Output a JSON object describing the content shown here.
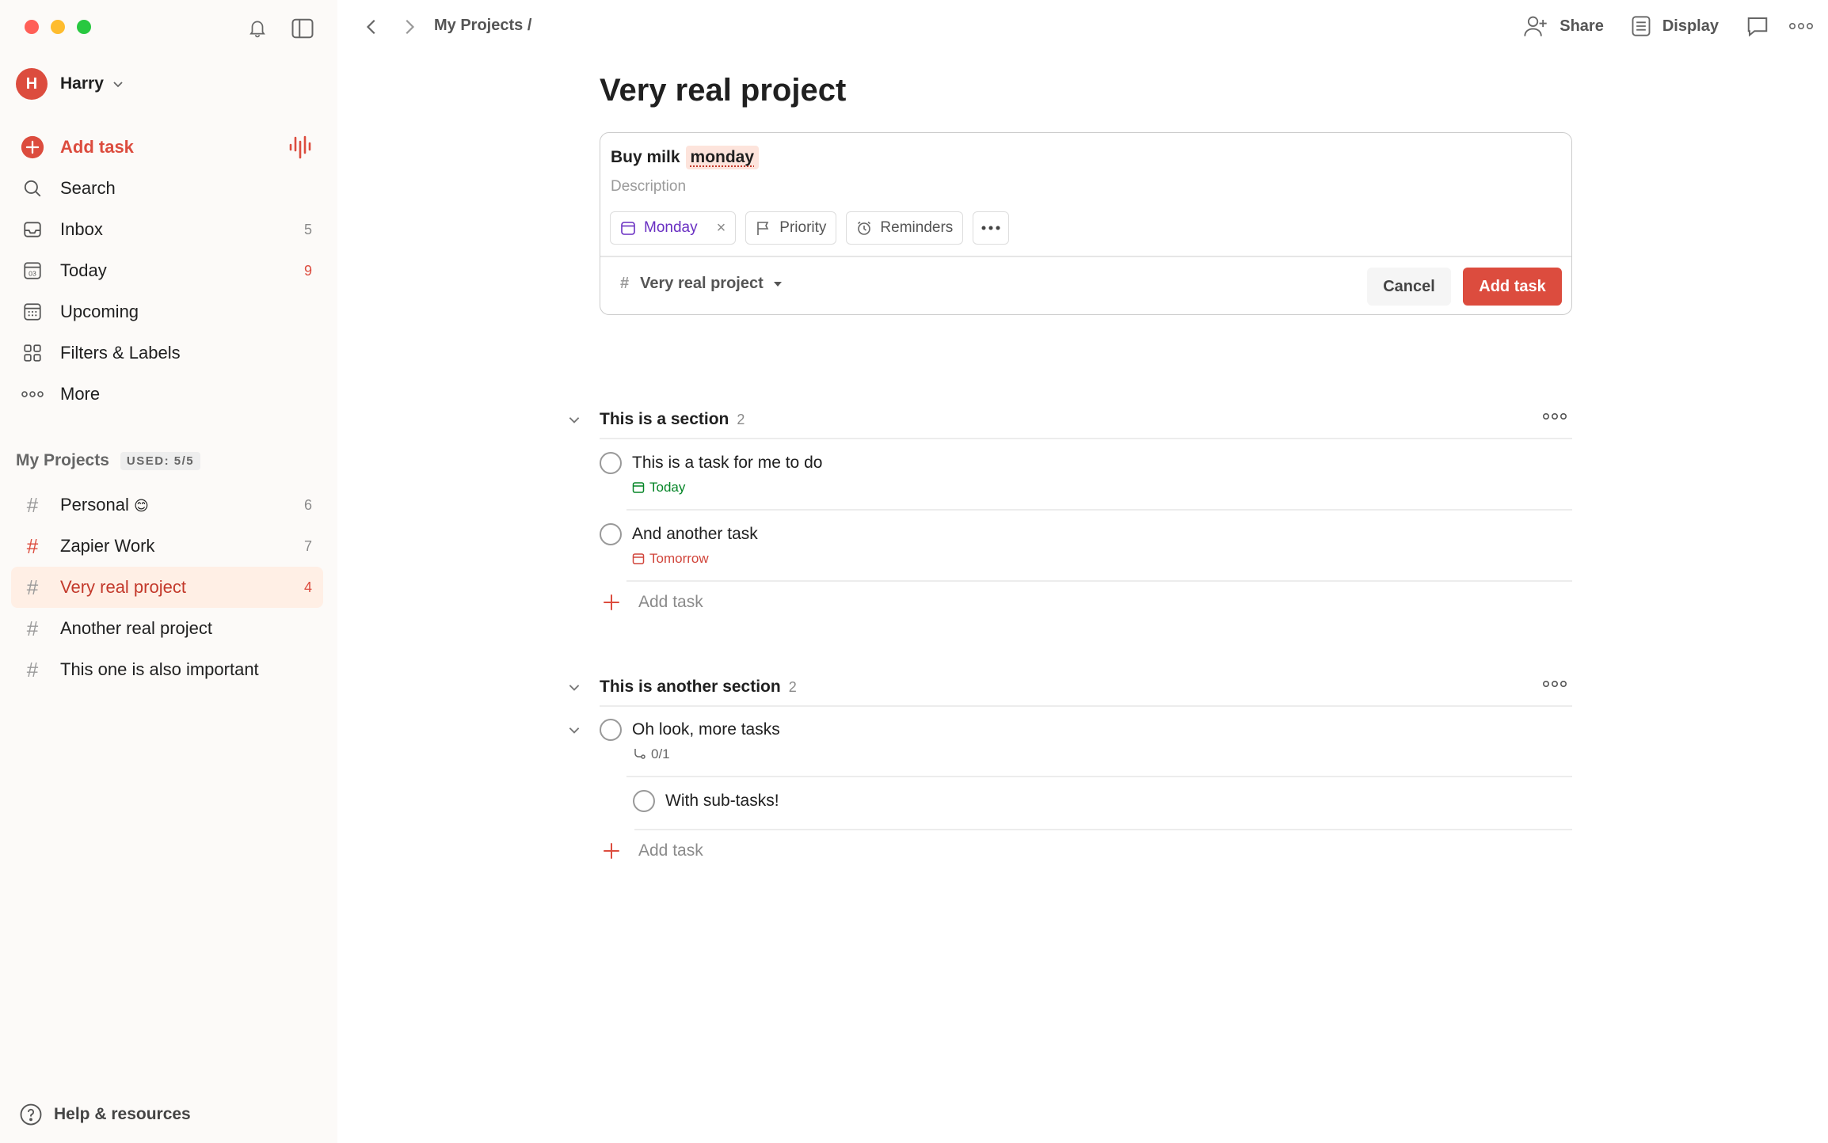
{
  "sidebar": {
    "user": {
      "initial": "H",
      "name": "Harry"
    },
    "nav": [
      {
        "label": "Add task",
        "icon": "plus-circle-icon"
      },
      {
        "label": "Search",
        "icon": "search-icon"
      },
      {
        "label": "Inbox",
        "icon": "inbox-icon",
        "count": "5"
      },
      {
        "label": "Today",
        "icon": "calendar-today-icon",
        "count": "9"
      },
      {
        "label": "Upcoming",
        "icon": "calendar-grid-icon"
      },
      {
        "label": "Filters & Labels",
        "icon": "filters-grid-icon"
      },
      {
        "label": "More",
        "icon": "more-dots-icon"
      }
    ],
    "projects_title": "My Projects",
    "projects_badge": "USED: 5/5",
    "projects": [
      {
        "label": "Personal",
        "emoji": "😊",
        "count": "6"
      },
      {
        "label": "Zapier Work",
        "count": "7"
      },
      {
        "label": "Very real project",
        "count": "4"
      },
      {
        "label": "Another real project"
      },
      {
        "label": "This one is also important"
      }
    ],
    "help_label": "Help & resources"
  },
  "topbar": {
    "breadcrumb": "My Projects /",
    "share_label": "Share",
    "display_label": "Display"
  },
  "main": {
    "title": "Very real project",
    "editor": {
      "task_name": "Buy milk",
      "task_highlight": "monday",
      "description_placeholder": "Description",
      "date_chip": "Monday",
      "date_chip_clear": "×",
      "priority_chip": "Priority",
      "reminders_chip": "Reminders",
      "project_hash": "#",
      "project": "Very real project",
      "cancel_label": "Cancel",
      "submit_label": "Add task"
    },
    "sections": [
      {
        "name": "This is a section",
        "count": "2",
        "tasks": [
          {
            "name": "This is a task for me to do",
            "due": "Today"
          },
          {
            "name": "And another task",
            "due": "Tomorrow"
          }
        ],
        "add_label": "Add task"
      },
      {
        "name": "This is another section",
        "count": "2",
        "tasks": [
          {
            "name": "Oh look, more tasks",
            "subtasks": "0/1"
          },
          {
            "name": "With sub-tasks!"
          }
        ],
        "add_label": "Add task"
      }
    ]
  },
  "colors": {
    "accent": "#dc4c3e",
    "today_green": "#058527",
    "date_purple": "#692fc2",
    "sidebar_bg": "#fcfaf8",
    "active_bg": "#ffefe5"
  }
}
